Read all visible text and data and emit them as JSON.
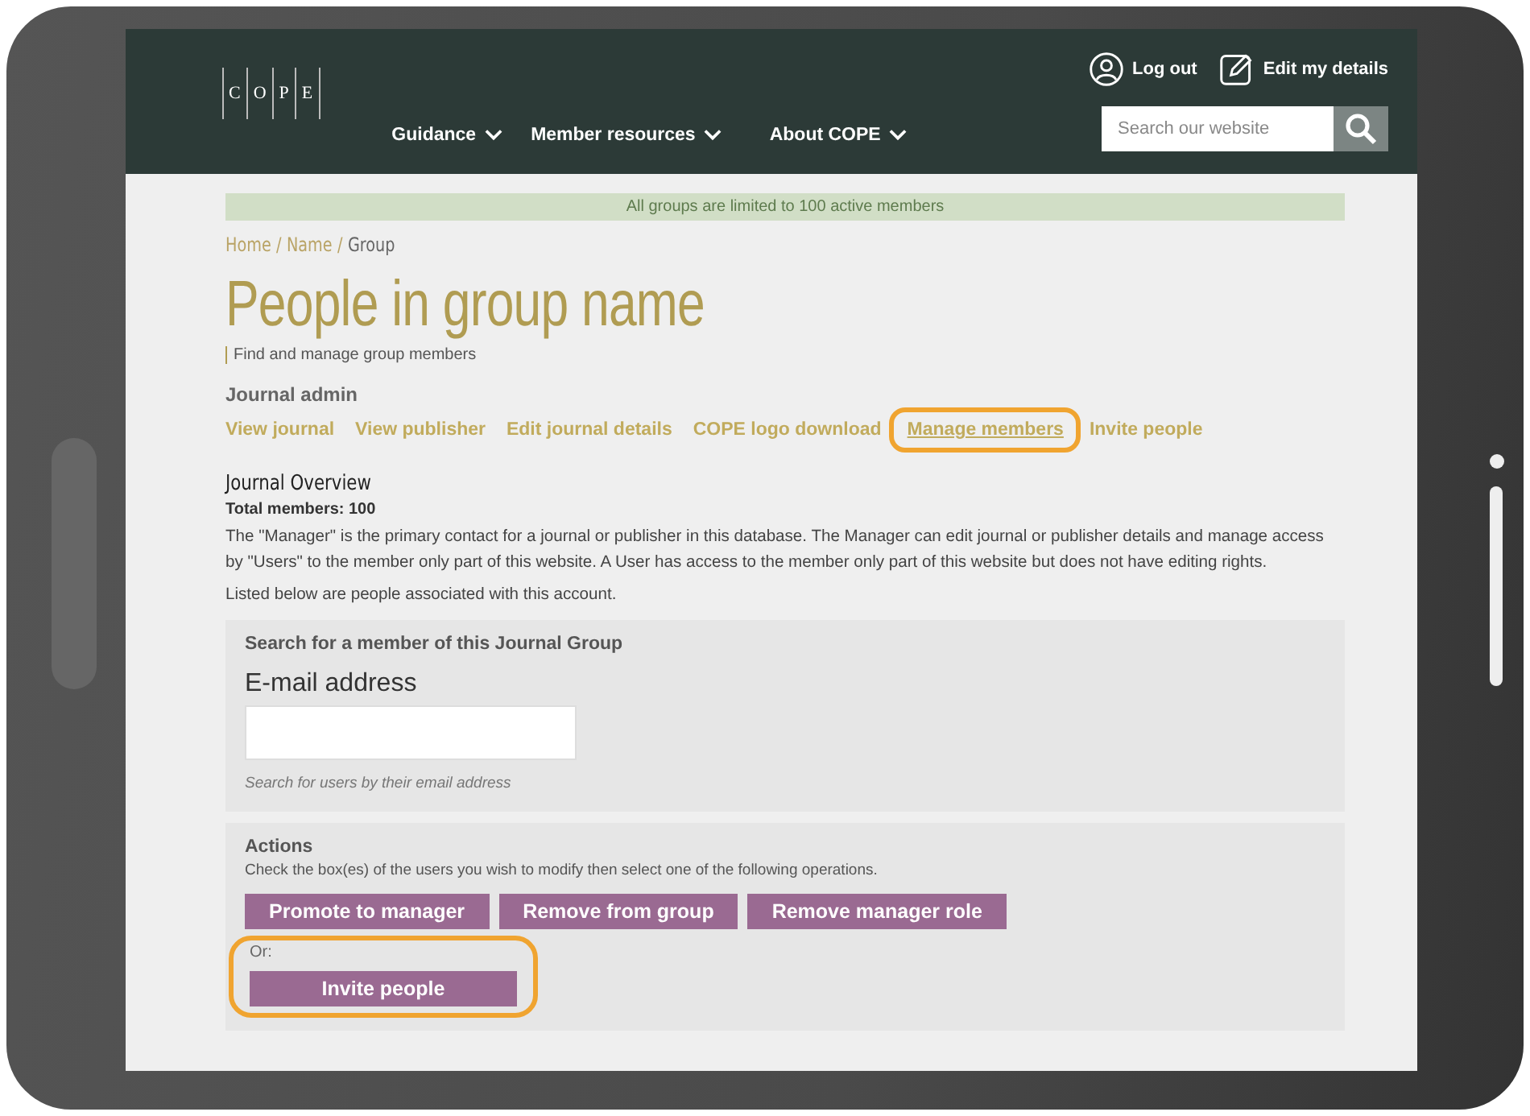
{
  "header": {
    "logo": [
      "C",
      "O",
      "P",
      "E"
    ],
    "nav": [
      {
        "label": "Guidance"
      },
      {
        "label": "Member resources"
      },
      {
        "label": "About COPE"
      }
    ],
    "account_links": [
      {
        "label": "Log out",
        "kind": "user"
      },
      {
        "label": "Edit my details",
        "kind": "edit"
      }
    ],
    "search": {
      "placeholder": "Search our website"
    }
  },
  "notice": "All groups are limited to 100 active members",
  "breadcrumb": {
    "separator": "/",
    "items": [
      {
        "label": "Home",
        "current": false
      },
      {
        "label": "Name",
        "current": false
      },
      {
        "label": "Group",
        "current": true
      }
    ]
  },
  "title": "People in group name",
  "subtitle": "Find and manage group members",
  "admin": {
    "heading": "Journal admin",
    "links": [
      {
        "label": "View journal",
        "highlighted": false
      },
      {
        "label": "View publisher",
        "highlighted": false
      },
      {
        "label": "Edit journal details",
        "highlighted": false
      },
      {
        "label": "COPE logo download",
        "highlighted": false
      },
      {
        "label": "Manage members",
        "highlighted": true
      },
      {
        "label": "Invite people",
        "highlighted": false
      }
    ]
  },
  "overview": {
    "heading": "Journal Overview",
    "total": "Total members: 100",
    "paragraphs": [
      "The \"Manager\" is the primary contact for a journal or publisher in this database. The Manager can edit journal or publisher details and manage access by \"Users\" to the member only part of this website. A User has access to the member only part of this website but does not have editing rights.",
      "Listed below are people associated with this account."
    ]
  },
  "search_panel": {
    "heading": "Search for a member of this Journal Group",
    "field_label": "E-mail address",
    "hint": "Search for users by their email address"
  },
  "actions": {
    "heading": "Actions",
    "instructions": "Check the box(es) of the users you wish to modify then select one of the following operations.",
    "buttons": [
      "Promote to manager",
      "Remove from group",
      "Remove manager role"
    ],
    "alternative": {
      "label": "Or:",
      "button": "Invite people",
      "highlighted": true
    }
  }
}
